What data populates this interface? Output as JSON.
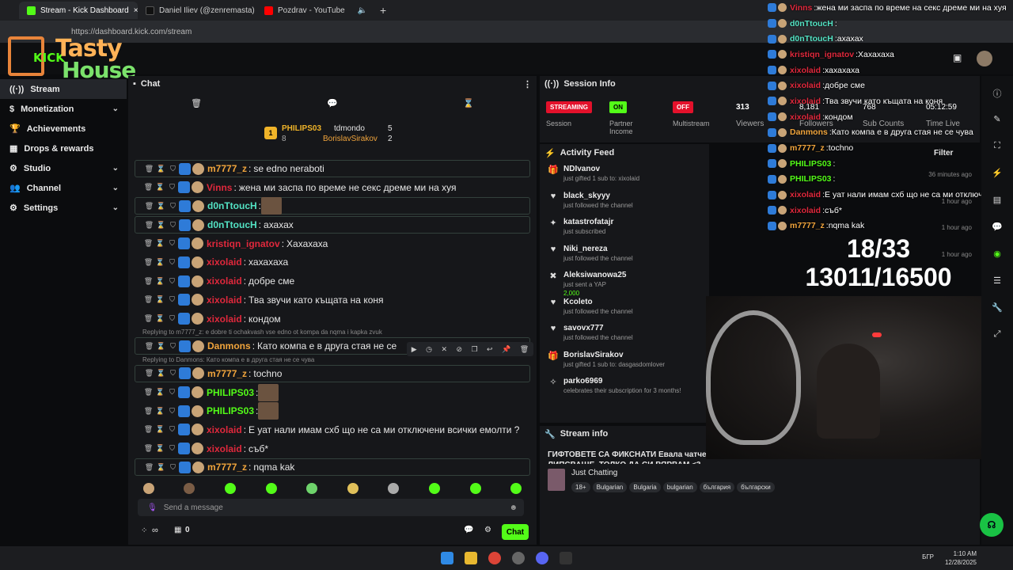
{
  "browser": {
    "tabs": [
      {
        "title": "Stream - Kick Dashboard",
        "color": "#53fc18"
      },
      {
        "title": "Daniel Iliev (@zenremasta) | Tik",
        "color": "#111111"
      },
      {
        "title": "Pozdrav - YouTube",
        "color": "#ff0000"
      }
    ],
    "url": "https://dashboard.kick.com/stream",
    "close": "×",
    "new_tab": "+"
  },
  "logo": {
    "line1": "Tasty",
    "line2": "House",
    "kick": "KICK"
  },
  "sidebar": {
    "items": [
      {
        "label": "Stream",
        "icon": "stream-icon",
        "glyph": "((·))",
        "chev": ""
      },
      {
        "label": "Monetization",
        "icon": "dollar-icon",
        "glyph": "$",
        "chev": "⌄"
      },
      {
        "label": "Achievements",
        "icon": "trophy-icon",
        "glyph": "🏆",
        "chev": ""
      },
      {
        "label": "Drops & rewards",
        "icon": "gift-icon",
        "glyph": "▦",
        "chev": ""
      },
      {
        "label": "Studio",
        "icon": "gear-icon",
        "glyph": "⚙",
        "chev": "⌄"
      },
      {
        "label": "Channel",
        "icon": "people-icon",
        "glyph": "👥",
        "chev": "⌄"
      },
      {
        "label": "Settings",
        "icon": "settings-icon",
        "glyph": "⚙",
        "chev": "⌄"
      }
    ]
  },
  "chat": {
    "title": "Chat",
    "menu": "⋮",
    "leaderboard": {
      "first": {
        "rank": "1",
        "name": "PHILIPS03",
        "count": "8"
      },
      "others": [
        {
          "name": "tdmondo",
          "count": "5"
        },
        {
          "name": "BorislavSirakov",
          "count": "2"
        }
      ]
    },
    "messages": [
      {
        "user": "m7777_z",
        "color": "#f0a43c",
        "text": "se edno neraboti",
        "boxed": true,
        "reply": ""
      },
      {
        "user": "Vinns",
        "color": "#e0283c",
        "text": "жена ми заспа по време не секс дреме ми на хуя",
        "boxed": false,
        "reply": ""
      },
      {
        "user": "d0nTtoucH",
        "color": "#53e3c4",
        "text": "",
        "emote": true,
        "boxed": true,
        "reply": ""
      },
      {
        "user": "d0nTtoucH",
        "color": "#53e3c4",
        "text": "ахахах",
        "boxed": true,
        "reply": ""
      },
      {
        "user": "kristiqn_ignatov",
        "color": "#e0283c",
        "text": "Хахахаха",
        "boxed": false,
        "reply": ""
      },
      {
        "user": "xixolaid",
        "color": "#e0283c",
        "text": "хахахаха",
        "boxed": false,
        "reply": ""
      },
      {
        "user": "xixolaid",
        "color": "#e0283c",
        "text": "добре сме",
        "boxed": false,
        "reply": ""
      },
      {
        "user": "xixolaid",
        "color": "#e0283c",
        "text": "Тва звучи като къщата на коня",
        "boxed": false,
        "reply": ""
      },
      {
        "user": "xixolaid",
        "color": "#e0283c",
        "text": "кондом",
        "boxed": false,
        "reply": ""
      },
      {
        "user": "Danmons",
        "color": "#f0a43c",
        "text": "Като компа е в друга стая не се",
        "boxed": true,
        "reply": "Replying to m7777_z: e dobre ti ochakvash vse edno ot kompa da nqma i kapka zvuk"
      },
      {
        "user": "m7777_z",
        "color": "#f0a43c",
        "text": "tochno",
        "boxed": true,
        "reply": "Replying to Danmons: Като компа е в друга стая не се чува"
      },
      {
        "user": "PHILIPS03",
        "color": "#53fc18",
        "text": "",
        "emote": true,
        "boxed": false,
        "reply": ""
      },
      {
        "user": "PHILIPS03",
        "color": "#53fc18",
        "text": "",
        "emote": true,
        "boxed": false,
        "reply": ""
      },
      {
        "user": "xixolaid",
        "color": "#e0283c",
        "text": "Е уат нали имам схб що не са ми отключени всички емолти ?",
        "boxed": false,
        "reply": ""
      },
      {
        "user": "xixolaid",
        "color": "#e0283c",
        "text": "съб*",
        "boxed": false,
        "reply": ""
      },
      {
        "user": "m7777_z",
        "color": "#f0a43c",
        "text": "nqma kak",
        "boxed": true,
        "reply": ""
      }
    ],
    "input_placeholder": "Send a message",
    "infinity": "∞",
    "counter": "0",
    "send_label": "Chat"
  },
  "session": {
    "title": "Session Info",
    "kpis": [
      {
        "pill": "STREAMING",
        "color": "#e3112b",
        "label": "Session"
      },
      {
        "pill": "ON",
        "color": "#53fc18",
        "label": "Partner Income"
      },
      {
        "pill": "OFF",
        "color": "#e3112b",
        "label": "Multistream"
      }
    ],
    "viewers": {
      "value": "313",
      "label": "Viewers"
    },
    "followers": {
      "value": "8,181",
      "label": "Followers"
    },
    "subs": {
      "value": "768",
      "label": "Sub Counts"
    },
    "time": {
      "value": "05:12:59",
      "label": "Time Live"
    }
  },
  "activity": {
    "title": "Activity Feed",
    "filter": "Filter",
    "items": [
      {
        "name": "NDIvanov",
        "sub": "just gifted 1 sub to: xixolaid",
        "time": "36 minutes ago",
        "icon": "gift-icon",
        "glyph": "🎁"
      },
      {
        "name": "black_skyyy",
        "sub": "just followed the channel",
        "time": "1 hour ago",
        "icon": "heart-icon",
        "glyph": "♥"
      },
      {
        "name": "katastrofatajr",
        "sub": "just subscribed",
        "time": "1 hour ago",
        "icon": "star-icon",
        "glyph": "✦"
      },
      {
        "name": "Niki_nereza",
        "sub": "just followed the channel",
        "time": "1 hour ago",
        "icon": "heart-icon",
        "glyph": "♥"
      },
      {
        "name": "Aleksiwanowa25",
        "sub": "just sent a YAP",
        "extra": "2,000",
        "time": "",
        "icon": "yap-icon",
        "glyph": "✖"
      },
      {
        "name": "Kcoleto",
        "sub": "just followed the channel",
        "time": "",
        "icon": "heart-icon",
        "glyph": "♥"
      },
      {
        "name": "savovx777",
        "sub": "just followed the channel",
        "time": "",
        "icon": "heart-icon",
        "glyph": "♥"
      },
      {
        "name": "BorislavSirakov",
        "sub": "just gifted 1 sub to: dasgasdomlover",
        "time": "",
        "icon": "gift-icon",
        "glyph": "🎁"
      },
      {
        "name": "parko6969",
        "sub": "celebrates their subscription for 3 months!",
        "time": "",
        "icon": "party-icon",
        "glyph": "✧"
      }
    ]
  },
  "streaminfo": {
    "title": "Stream info",
    "stream_title": "ГИФТОВЕТЕ СА ФИКСНАТИ Евала чатчета <3 ОБИЧАМ ВИ И МНОГО МИ ЛИПСВАШЕ, ТОЛКО ДА СИ ВЯРВАМ <3",
    "category": "Just Chatting",
    "tags": [
      "18+",
      "Bulgarian",
      "Bulgaria",
      "bulgarian",
      "българия",
      "български"
    ]
  },
  "overlay": {
    "lines": [
      {
        "user": "Vinns",
        "color": "#e0283c",
        "text": "жена ми заспа по време на секс дреме ми на хуя"
      },
      {
        "user": "d0nTtoucH",
        "color": "#53e3c4",
        "text": ""
      },
      {
        "user": "d0nTtoucH",
        "color": "#53e3c4",
        "text": "ахахах"
      },
      {
        "user": "kristiqn_ignatov",
        "color": "#e0283c",
        "text": "Хахахаха"
      },
      {
        "user": "xixolaid",
        "color": "#e0283c",
        "text": "хахахаха"
      },
      {
        "user": "xixolaid",
        "color": "#e0283c",
        "text": "добре сме"
      },
      {
        "user": "xixolaid",
        "color": "#e0283c",
        "text": "Тва звучи като къщата на коня"
      },
      {
        "user": "xixolaid",
        "color": "#e0283c",
        "text": "кондом"
      },
      {
        "user": "Danmons",
        "color": "#f0a43c",
        "text": "Като компа е в друга стая не се чува"
      },
      {
        "user": "m7777_z",
        "color": "#f0a43c",
        "text": "tochno"
      },
      {
        "user": "PHILIPS03",
        "color": "#53fc18",
        "text": ""
      },
      {
        "user": "PHILIPS03",
        "color": "#53fc18",
        "text": ""
      },
      {
        "user": "xixolaid",
        "color": "#e0283c",
        "text": "Е уат нали имам схб що не са ми отключени всички"
      },
      {
        "user": "xixolaid",
        "color": "#e0283c",
        "text": "съб*"
      },
      {
        "user": "m7777_z",
        "color": "#f0a43c",
        "text": "nqma kak"
      }
    ],
    "goal1": "18/33",
    "goal2": "13011/16500"
  },
  "taskbar": {
    "time": "1:10 AM",
    "date": "12/28/2025",
    "lang": "БГР"
  }
}
